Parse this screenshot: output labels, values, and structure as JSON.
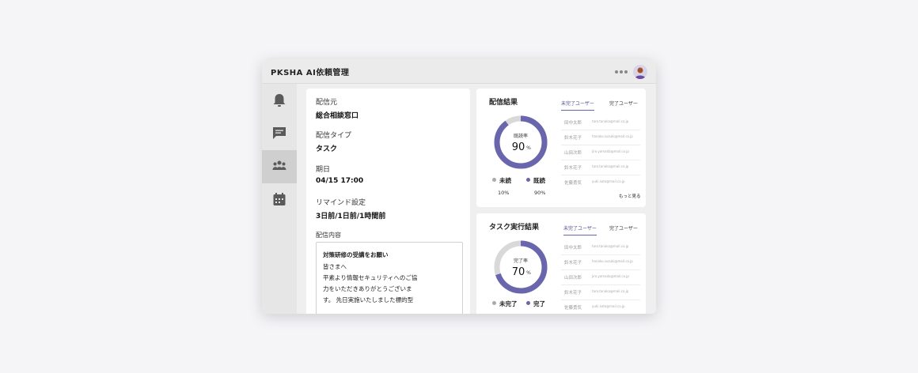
{
  "app": {
    "title": "PKSHA AI依頼管理"
  },
  "colors": {
    "accent": "#6a66ad",
    "track": "#d9d9d9"
  },
  "sidebar": {
    "items": [
      {
        "icon": "bell-icon",
        "active": false
      },
      {
        "icon": "chat-icon",
        "active": false
      },
      {
        "icon": "team-icon",
        "active": true
      },
      {
        "icon": "calendar-icon",
        "active": false
      }
    ]
  },
  "detail": {
    "source_label": "配信元",
    "source_value": "総合相談窓口",
    "type_label": "配信タイプ",
    "type_value": "タスク",
    "due_label": "期日",
    "due_value": "04/15 17:00",
    "remind_label": "リマインド設定",
    "remind_value": "3日前/1日前/1時間前",
    "content_label": "配信内容",
    "message_lines": [
      "対策研修の受講をお願い",
      "皆さまへ",
      "平素より情報セキュリティへのご協",
      "力をいただきありがとうございま",
      "す。 先日実施いたしました標的型"
    ]
  },
  "delivery": {
    "title": "配信結果",
    "tabs": [
      "未完了ユーザー",
      "完了ユーザー"
    ],
    "active_tab": 0,
    "donut_label": "既読率",
    "donut_value": "90",
    "donut_unit": "%",
    "donut_fraction": 0.9,
    "legend": [
      {
        "label": "未読",
        "percent": "10%"
      },
      {
        "label": "既読",
        "percent": "90%"
      }
    ],
    "users": [
      {
        "name": "田中太郎",
        "email": "taro.tanaka@mail.co.jp"
      },
      {
        "name": "鈴木花子",
        "email": "hanako.suzuki@mail.co.jp"
      },
      {
        "name": "山田次郎",
        "email": "jiro.yamada@mail.co.jp"
      },
      {
        "name": "鈴木花子",
        "email": "taro.tanaka@mail.co.jp"
      },
      {
        "name": "佐藤勇気",
        "email": "yuki.sato@mail.co.jp"
      }
    ],
    "more_label": "もっと見る"
  },
  "task": {
    "title": "タスク実行結果",
    "tabs": [
      "未完了ユーザー",
      "完了ユーザー"
    ],
    "active_tab": 0,
    "donut_label": "完了率",
    "donut_value": "70",
    "donut_unit": "%",
    "donut_fraction": 0.7,
    "legend": [
      {
        "label": "未完了"
      },
      {
        "label": "完了"
      }
    ],
    "users": [
      {
        "name": "田中太郎",
        "email": "taro.tanaka@mail.co.jp"
      },
      {
        "name": "鈴木花子",
        "email": "hanako.suzuki@mail.co.jp"
      },
      {
        "name": "山田次郎",
        "email": "jiro.yamada@mail.co.jp"
      },
      {
        "name": "鈴木花子",
        "email": "taro.tanaka@mail.co.jp"
      },
      {
        "name": "佐藤勇気",
        "email": "yuki.sato@mail.co.jp"
      }
    ]
  }
}
